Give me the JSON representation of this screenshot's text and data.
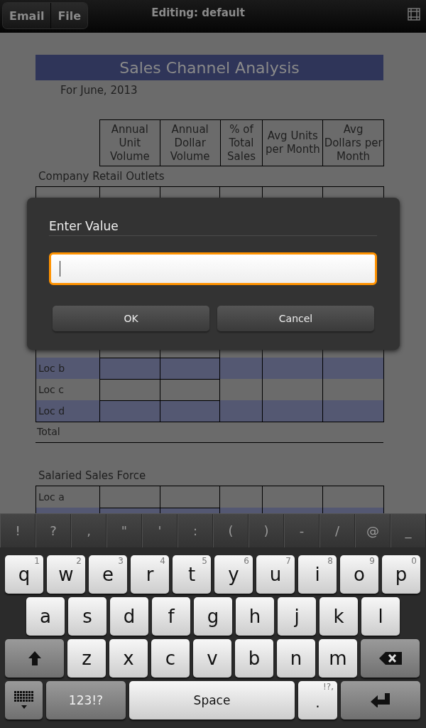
{
  "top_bar": {
    "buttons": [
      "Email",
      "File"
    ],
    "title": "Editing: default"
  },
  "document": {
    "title": "Sales Channel Analysis",
    "subtitle": "For June, 2013",
    "columns": [
      "Annual Unit Volume",
      "Annual Dollar Volume",
      "% of Total Sales",
      "Avg Units per Month",
      "Avg Dollars per Month"
    ],
    "sections": [
      {
        "heading": "Company Retail Outlets",
        "total": "Total",
        "rows": [
          {
            "kind": "row"
          },
          {
            "kind": "covered"
          },
          {
            "kind": "row"
          },
          {
            "kind": "row",
            "label": "Loc b"
          },
          {
            "kind": "row",
            "label": "Loc c"
          },
          {
            "kind": "row",
            "label": "Loc d"
          }
        ]
      },
      {
        "heading": "Salaried Sales Force",
        "rows": [
          {
            "kind": "row",
            "label": "Loc a"
          },
          {
            "kind": "row"
          }
        ]
      }
    ]
  },
  "dialog": {
    "title": "Enter Value",
    "buttons": [
      "OK",
      "Cancel"
    ]
  },
  "keyboard": {
    "symbols": [
      "!",
      "?",
      ",",
      "\"",
      "'",
      ":",
      "(",
      ")",
      "-",
      "/",
      "@",
      "_"
    ],
    "rows": [
      {
        "keys": [
          {
            "kind": "letter",
            "label": "q",
            "hint": "1"
          },
          {
            "kind": "letter",
            "label": "w",
            "hint": "2"
          },
          {
            "kind": "letter",
            "label": "e",
            "hint": "3"
          },
          {
            "kind": "letter",
            "label": "r",
            "hint": "4"
          },
          {
            "kind": "letter",
            "label": "t",
            "hint": "5"
          },
          {
            "kind": "letter",
            "label": "y",
            "hint": "6"
          },
          {
            "kind": "letter",
            "label": "u",
            "hint": "7"
          },
          {
            "kind": "letter",
            "label": "i",
            "hint": "8"
          },
          {
            "kind": "letter",
            "label": "o",
            "hint": "9"
          },
          {
            "kind": "letter",
            "label": "p",
            "hint": "0"
          }
        ]
      },
      {
        "keys": [
          {
            "kind": "letter",
            "label": "a"
          },
          {
            "kind": "letter",
            "label": "s"
          },
          {
            "kind": "letter",
            "label": "d"
          },
          {
            "kind": "letter",
            "label": "f"
          },
          {
            "kind": "letter",
            "label": "g"
          },
          {
            "kind": "letter",
            "label": "h"
          },
          {
            "kind": "letter",
            "label": "j"
          },
          {
            "kind": "letter",
            "label": "k"
          },
          {
            "kind": "letter",
            "label": "l"
          }
        ]
      },
      {
        "keys": [
          {
            "kind": "shift"
          },
          {
            "kind": "letter",
            "label": "z"
          },
          {
            "kind": "letter",
            "label": "x"
          },
          {
            "kind": "letter",
            "label": "c"
          },
          {
            "kind": "letter",
            "label": "v"
          },
          {
            "kind": "letter",
            "label": "b"
          },
          {
            "kind": "letter",
            "label": "n"
          },
          {
            "kind": "letter",
            "label": "m"
          },
          {
            "kind": "backspace"
          }
        ]
      },
      {
        "keys": [
          {
            "kind": "hide"
          },
          {
            "kind": "mode",
            "label": "123!?"
          },
          {
            "kind": "space",
            "label": "Space"
          },
          {
            "kind": "period",
            "label": ".",
            "hint": "!?,"
          },
          {
            "kind": "enter"
          }
        ]
      }
    ]
  }
}
